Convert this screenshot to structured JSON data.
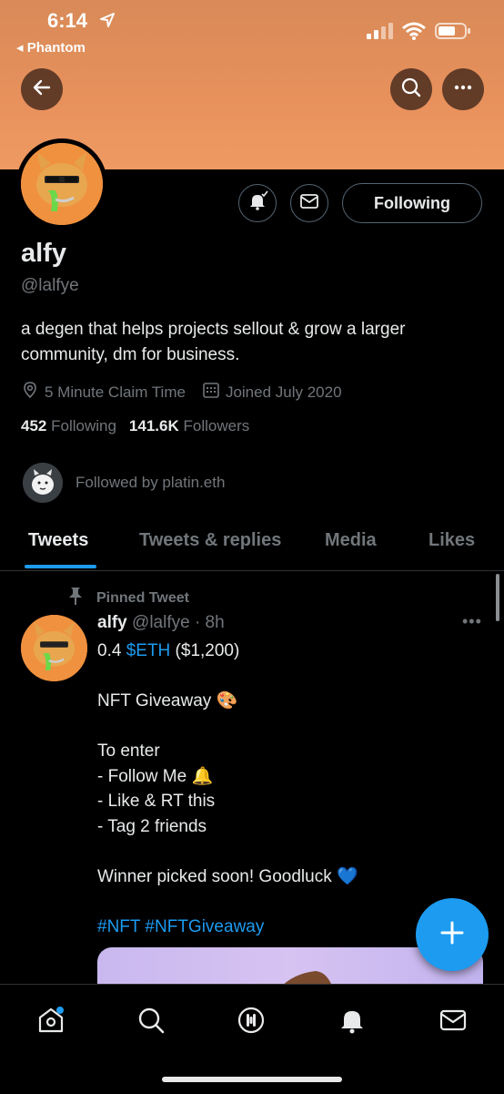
{
  "status_bar": {
    "time": "6:14",
    "back_app": "Phantom"
  },
  "profile": {
    "name": "alfy",
    "handle": "@lalfye",
    "bio": "a degen that helps projects sellout & grow a larger community, dm for business.",
    "location": "5 Minute Claim Time",
    "joined": "Joined July 2020",
    "following_count": "452",
    "following_label": "Following",
    "followers_count": "141.6K",
    "followers_label": "Followers",
    "followed_by": "Followed by platin.eth",
    "follow_button": "Following"
  },
  "tabs": [
    {
      "label": "Tweets",
      "active": true
    },
    {
      "label": "Tweets & replies",
      "active": false
    },
    {
      "label": "Media",
      "active": false
    },
    {
      "label": "Likes",
      "active": false
    }
  ],
  "pinned_tweet": {
    "pinned_label": "Pinned Tweet",
    "author": "alfy",
    "handle_time": "@lalfye · 8h",
    "line1_prefix": "0.4 ",
    "line1_link": "$ETH",
    "line1_suffix": " ($1,200)",
    "line2": "NFT Giveaway 🎨",
    "line3": "To enter",
    "line4": "- Follow Me 🔔",
    "line5": "- Like & RT this",
    "line6": "- Tag 2 friends",
    "line7": "Winner picked soon! Goodluck 💙",
    "hashtags": "#NFT #NFTGiveaway",
    "more": "•••"
  },
  "colors": {
    "accent": "#1d9bf0",
    "banner": "#e8915d",
    "background": "#000000",
    "muted": "#71767b"
  },
  "icons": [
    "back-arrow-icon",
    "search-icon",
    "more-icon",
    "bell-notify-icon",
    "mail-icon",
    "location-icon",
    "calendar-icon",
    "pin-icon",
    "compose-plus-icon",
    "home-icon",
    "spaces-icon",
    "bell-icon"
  ]
}
